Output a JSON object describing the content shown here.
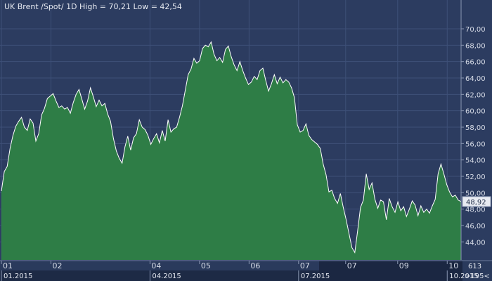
{
  "header": {
    "instrument": "UK Brent /Spot/",
    "interval": "1D",
    "high_label": "High =",
    "high_value": "70,21",
    "low_label": "Low =",
    "low_value": "42,54"
  },
  "nav": {
    "bar_count": "613",
    "scroll_indicator": ">195<"
  },
  "colors": {
    "background": "#2c3c60",
    "fill": "#2e7d46",
    "line": "#ffffff",
    "grid": "#3e5078",
    "panel": "#1d2a45"
  },
  "chart_data": {
    "type": "area",
    "title": "UK Brent /Spot/ 1D High = 70,21 Low = 42,54",
    "xlabel": "",
    "ylabel": "",
    "ylim": [
      41.8,
      71.8
    ],
    "y_ticks": [
      "44,00",
      "46,00",
      "48,00",
      "50,00",
      "52,00",
      "54,00",
      "56,00",
      "58,00",
      "60,00",
      "62,00",
      "64,00",
      "66,00",
      "68,00",
      "70,00"
    ],
    "x_ticks": [
      "01",
      "02",
      "04",
      "05",
      "06",
      "07",
      "07",
      "09",
      "10"
    ],
    "x_ticks_month_index": [
      0,
      1,
      3,
      4,
      5,
      6,
      6.95,
      8,
      9
    ],
    "period_labels": [
      {
        "label": "01.2015",
        "month_index": 0
      },
      {
        "label": "04.2015",
        "month_index": 3
      },
      {
        "label": "07.2015",
        "month_index": 6
      },
      {
        "label": "10.2015",
        "month_index": 9
      }
    ],
    "last_value": "48,92",
    "series": [
      {
        "values": [
          50.2,
          52.6,
          53.2,
          55.4,
          57.0,
          58.1,
          58.7,
          59.2,
          58.0,
          57.6,
          59.0,
          58.5,
          56.3,
          57.2,
          59.5,
          60.3,
          61.5,
          61.8,
          62.1,
          61.2,
          60.4,
          60.6,
          60.2,
          60.4,
          59.7,
          61.0,
          62.0,
          62.6,
          61.4,
          60.2,
          61.2,
          62.8,
          61.7,
          60.5,
          61.3,
          60.6,
          60.9,
          59.6,
          58.7,
          56.6,
          55.1,
          54.2,
          53.6,
          55.6,
          56.9,
          55.2,
          56.7,
          57.2,
          58.9,
          58.0,
          57.7,
          57.0,
          55.9,
          56.6,
          57.2,
          56.1,
          57.6,
          56.3,
          58.9,
          57.4,
          57.8,
          58.0,
          59.2,
          60.6,
          62.5,
          64.4,
          65.1,
          66.4,
          65.8,
          66.1,
          67.6,
          68.0,
          67.8,
          68.4,
          66.9,
          66.1,
          66.5,
          65.9,
          67.5,
          67.9,
          66.6,
          65.6,
          64.9,
          66.0,
          64.9,
          64.0,
          63.2,
          63.5,
          64.2,
          63.8,
          64.9,
          65.2,
          63.7,
          62.4,
          63.3,
          64.4,
          63.3,
          64.1,
          63.4,
          63.8,
          63.5,
          62.8,
          61.6,
          58.3,
          57.4,
          57.6,
          58.4,
          57.0,
          56.5,
          56.2,
          55.9,
          55.4,
          53.5,
          52.2,
          50.1,
          50.3,
          49.3,
          48.7,
          49.9,
          48.2,
          46.7,
          45.0,
          43.3,
          42.7,
          45.4,
          48.2,
          49.1,
          52.3,
          50.4,
          51.2,
          49.2,
          48.1,
          49.1,
          48.9,
          46.7,
          49.3,
          48.3,
          47.6,
          48.9,
          47.8,
          48.3,
          47.1,
          48.0,
          49.0,
          48.5,
          47.2,
          48.4,
          47.6,
          48.0,
          47.5,
          48.4,
          49.2,
          52.3,
          53.5,
          52.3,
          51.0,
          50.1,
          49.5,
          49.7,
          49.1,
          48.92
        ]
      }
    ]
  }
}
